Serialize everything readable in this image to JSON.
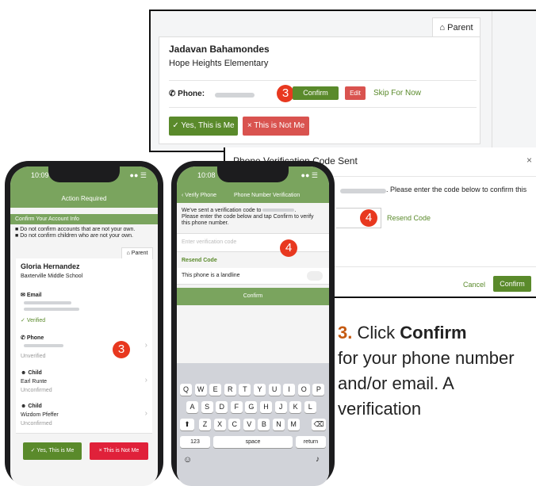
{
  "desktop": {
    "tab_label": "Parent",
    "name": "Jadavan Bahamondes",
    "school": "Hope Heights Elementary",
    "phone_label": "Phone:",
    "confirm": "Confirm",
    "edit": "Edit",
    "skip": "Skip For Now",
    "yes": "Yes, This is Me",
    "no": "This is Not Me",
    "step_badge": "3"
  },
  "modal": {
    "title": "Phone Verification Code Sent",
    "close": "×",
    "message": ". Please enter the code below to confirm this",
    "resend": "Resend Code",
    "cancel": "Cancel",
    "confirm": "Confirm",
    "step_badge": "4"
  },
  "phone1": {
    "time": "10:09",
    "header": "Action Required",
    "banner": "Confirm Your Account Info",
    "bullet1": "Do not confirm accounts that are not your own.",
    "bullet2": "Do not confirm children who are not your own.",
    "tab": "Parent",
    "name": "Gloria Hernandez",
    "school": "Baxterville Middle School",
    "email_label": "Email",
    "email_status": "Verified",
    "phone_label": "Phone",
    "phone_status": "Unverified",
    "child1_label": "Child",
    "child1_name": "Earl Runte",
    "child1_status": "Unconfirmed",
    "child2_label": "Child",
    "child2_name": "Wizdom Pfeffer",
    "child2_status": "Unconfirmed",
    "yes": "Yes, This is Me",
    "no": "This is Not Me",
    "step_badge": "3"
  },
  "phone2": {
    "time": "10:08",
    "back": "Verify Phone",
    "header": "Phone Number Verification",
    "msg1": "We've sent a verification code to",
    "msg2": "Please enter the code below and tap Confirm to verify this phone number.",
    "placeholder": "Enter verification code",
    "resend": "Resend Code",
    "landline": "This phone is a landline",
    "confirm": "Confirm",
    "step_badge": "4",
    "row1": [
      "Q",
      "W",
      "E",
      "R",
      "T",
      "Y",
      "U",
      "I",
      "O",
      "P"
    ],
    "row2": [
      "A",
      "S",
      "D",
      "F",
      "G",
      "H",
      "J",
      "K",
      "L"
    ],
    "row3": [
      "Z",
      "X",
      "C",
      "V",
      "B",
      "N",
      "M"
    ],
    "num_key": "123",
    "space_key": "space",
    "return_key": "return"
  },
  "caption": {
    "num": "3.",
    "pre": " Click ",
    "bold": "Confirm",
    "rest": "for your phone number and/or email.  A verification"
  },
  "colors": {
    "green": "#5a8a2b",
    "red": "#d9534f",
    "badge": "#e8381f",
    "header": "#7aa45e"
  }
}
